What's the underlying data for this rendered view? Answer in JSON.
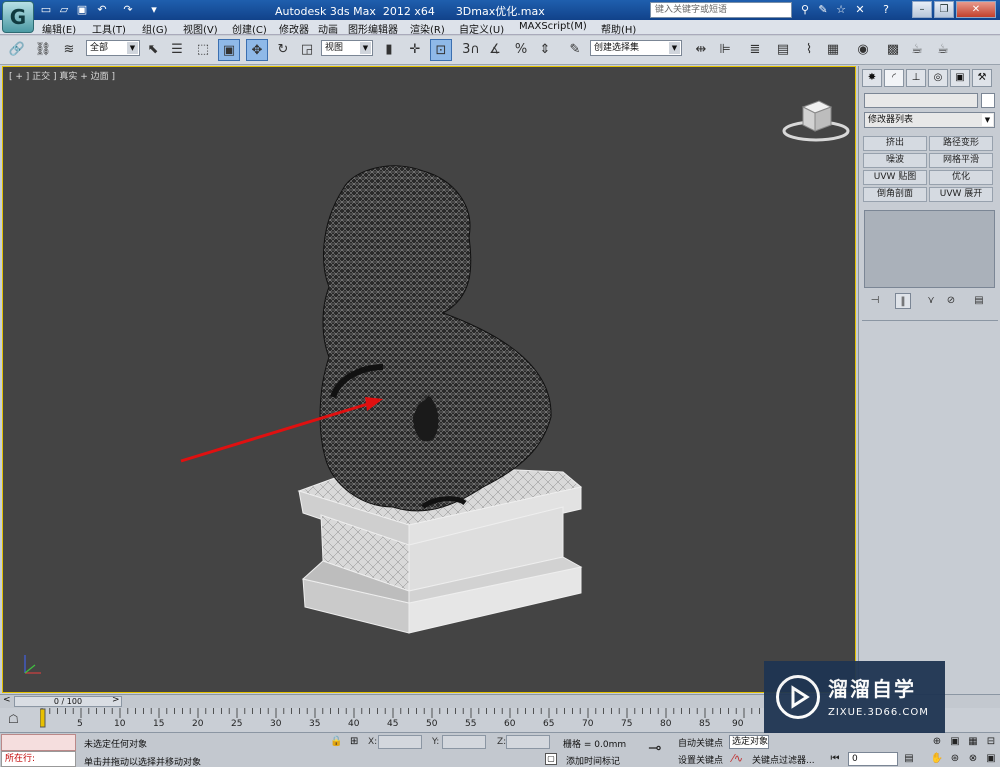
{
  "window": {
    "app_title": "Autodesk 3ds Max  2012 x64",
    "file_name": "3Dmax优化.max",
    "search_placeholder": "键入关键字或短语"
  },
  "menu": [
    {
      "label": "编辑(E)"
    },
    {
      "label": "工具(T)"
    },
    {
      "label": "组(G)"
    },
    {
      "label": "视图(V)"
    },
    {
      "label": "创建(C)"
    },
    {
      "label": "修改器"
    },
    {
      "label": "动画"
    },
    {
      "label": "图形编辑器"
    },
    {
      "label": "渲染(R)"
    },
    {
      "label": "自定义(U)"
    },
    {
      "label": "MAXScript(M)"
    },
    {
      "label": "帮助(H)"
    }
  ],
  "toolbar": {
    "selection_filter": "全部",
    "ref_coord": "视图",
    "named_selection": "创建选择集"
  },
  "viewport": {
    "label": "[ + ] 正交 ] 真实 + 边面 ]"
  },
  "command_panel": {
    "modifier_list": "修改器列表",
    "modifier_buttons": [
      "挤出",
      "路径变形",
      "噪波",
      "网格平滑",
      "UVW 贴图",
      "优化",
      "倒角剖面",
      "UVW 展开"
    ]
  },
  "timeline": {
    "slider_label": "0 / 100",
    "ticks": [
      "5",
      "10",
      "15",
      "20",
      "25",
      "30",
      "35",
      "40",
      "45",
      "50",
      "55",
      "60",
      "65",
      "70",
      "75",
      "80",
      "85",
      "90"
    ]
  },
  "status": {
    "running_label": "所在行:",
    "selection_status": "未选定任何对象",
    "prompt": "单击并拖动以选择并移动对象",
    "x_label": "X:",
    "y_label": "Y:",
    "z_label": "Z:",
    "grid": "栅格 = 0.0mm",
    "add_time_tag": "添加时间标记",
    "auto_key": "自动关键点",
    "set_key": "设置关键点",
    "selection_set": "选定对象",
    "key_filters": "关键点过滤器...",
    "current_frame": "0"
  },
  "watermark": {
    "title": "溜溜自学",
    "url": "ZIXUE.3D66.COM"
  },
  "colors": {
    "viewport_bg": "#444444",
    "viewport_border": "#e2c000",
    "annotation_arrow": "#e01010",
    "title_bar": "#1a4f9a"
  }
}
